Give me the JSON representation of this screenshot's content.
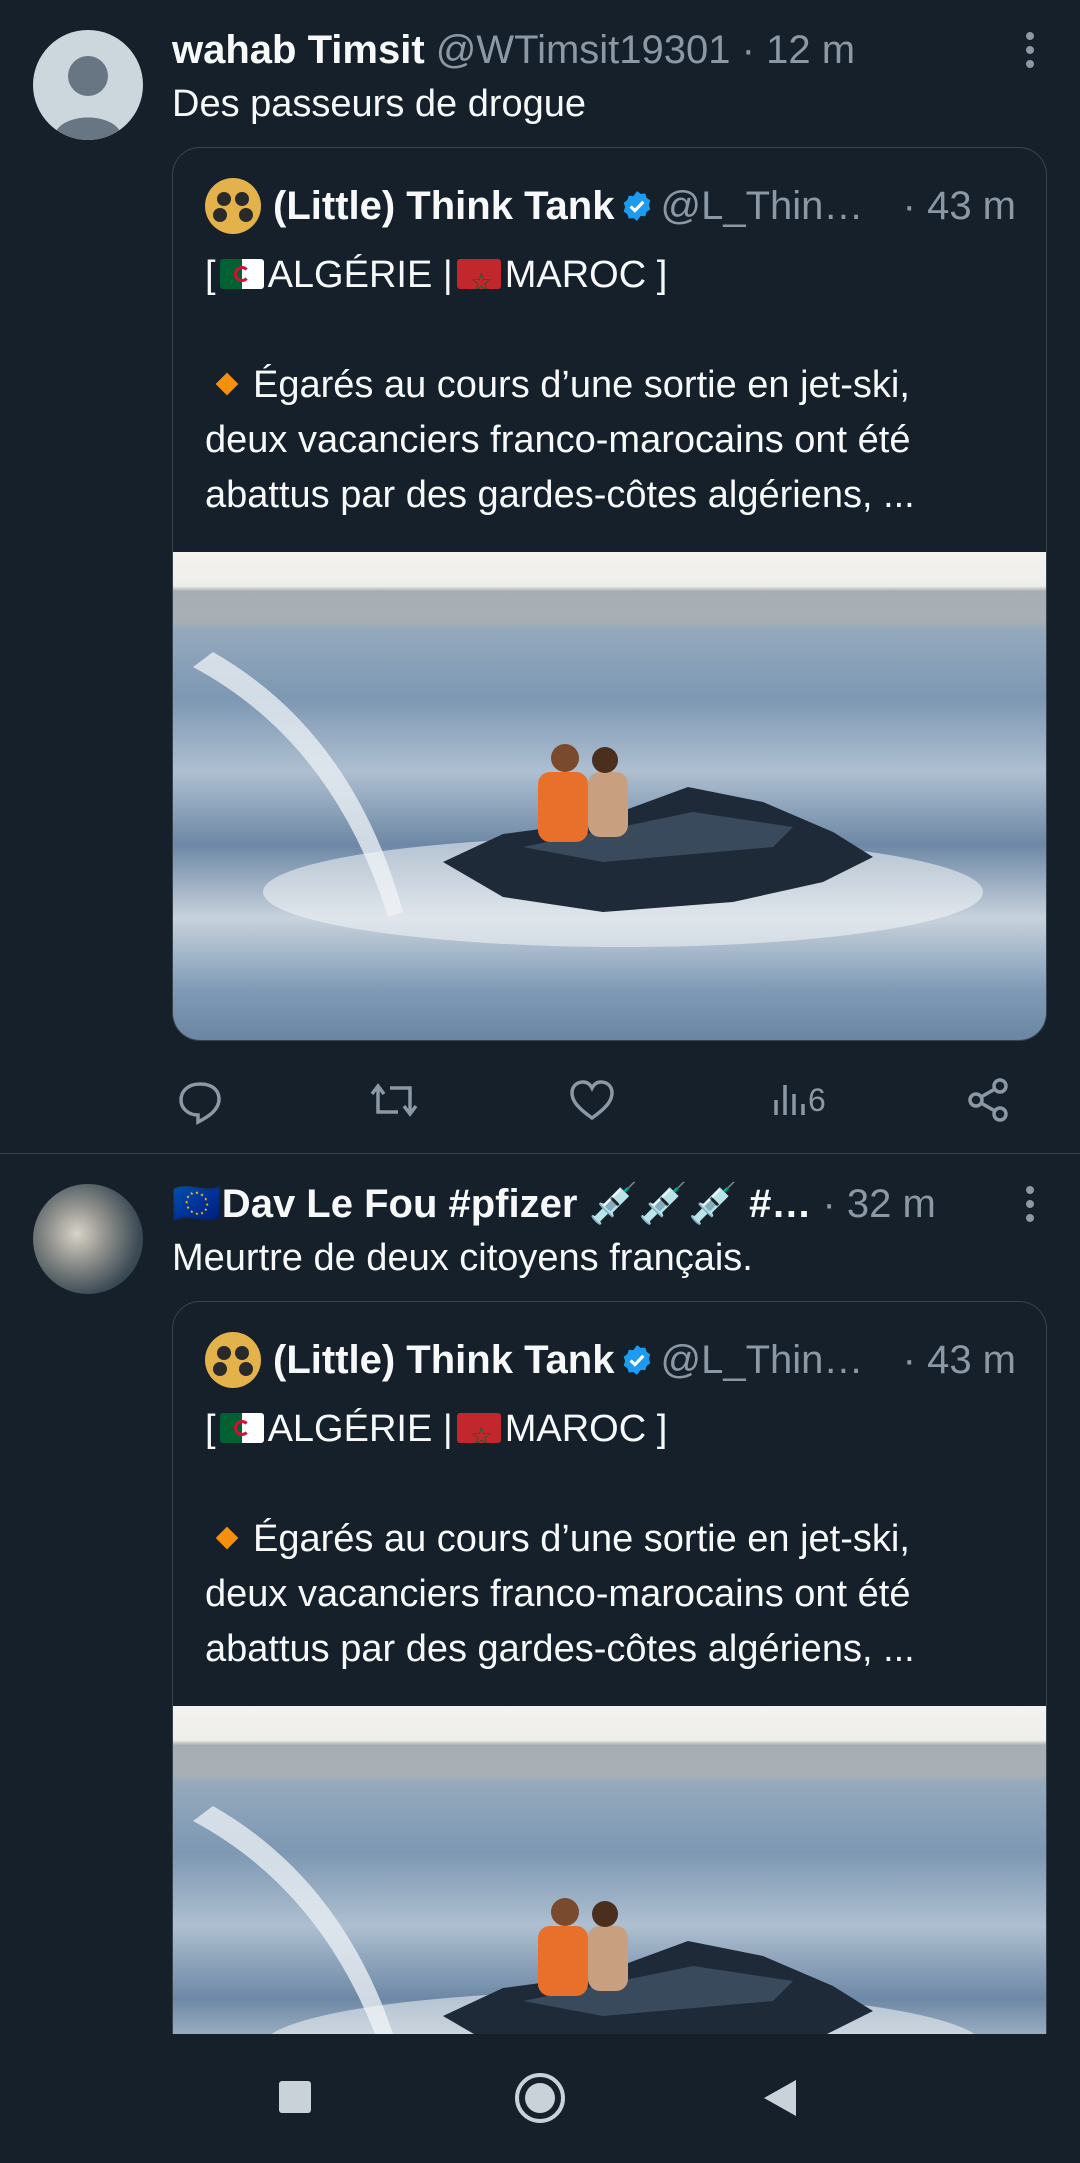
{
  "tweets": [
    {
      "name": "wahab Timsit",
      "handle": "@WTimsit19301",
      "separator": "·",
      "time": "12 m",
      "text": "Des passeurs de drogue",
      "quote": {
        "name": "(Little) Think Tank",
        "handle": "@L_Thin…",
        "time": "· 43 m",
        "line1_pre": "[",
        "line1_a": "ALGÉRIE |",
        "line1_b": "MAROC ]",
        "body_l1": "Égarés au cours d’une sortie en jet-ski,",
        "body_l2": "deux vacanciers franco-marocains ont été",
        "body_l3": "abattus par des gardes-côtes algériens, ..."
      },
      "views": "6"
    },
    {
      "name": "🇪🇺Dav Le Fou #pfizer 💉💉💉 #…",
      "separator": "·",
      "time": "32 m",
      "text": "Meurtre de deux citoyens français.",
      "quote": {
        "name": "(Little) Think Tank",
        "handle": "@L_Thin…",
        "time": "· 43 m",
        "line1_pre": "[",
        "line1_a": "ALGÉRIE |",
        "line1_b": "MAROC ]",
        "body_l1": "Égarés au cours d’une sortie en jet-ski,",
        "body_l2": "deux vacanciers franco-marocains ont été",
        "body_l3": "abattus par des gardes-côtes algériens, ..."
      }
    }
  ],
  "icons": {
    "reply": "reply-icon",
    "retweet": "retweet-icon",
    "like": "like-icon",
    "views": "views-icon",
    "share": "share-icon",
    "more": "more-icon",
    "verified": "verified-badge-icon"
  },
  "colors": {
    "background": "#15202b",
    "border": "#38444d",
    "secondary_text": "#8b98a5",
    "verified": "#1d9bf0"
  }
}
